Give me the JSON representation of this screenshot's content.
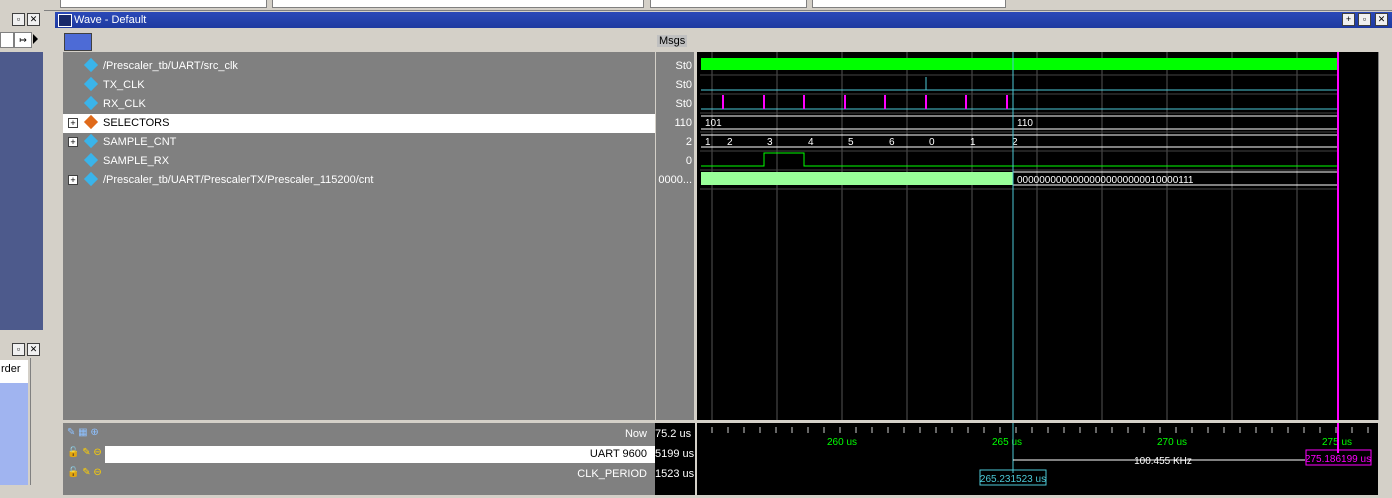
{
  "window": {
    "title": "Wave - Default",
    "toolbar_msgs_label": "Msgs"
  },
  "left_panel": {
    "list_item": "rder"
  },
  "signals": [
    {
      "name": "/Prescaler_tb/UART/src_clk",
      "value": "St0",
      "icon": "wire-icon",
      "expandable": false,
      "selected": false
    },
    {
      "name": "TX_CLK",
      "value": "St0",
      "icon": "wire-icon",
      "expandable": false,
      "selected": false
    },
    {
      "name": "RX_CLK",
      "value": "St0",
      "icon": "wire-icon",
      "expandable": false,
      "selected": false
    },
    {
      "name": "SELECTORS",
      "value": "110",
      "icon": "bus-icon",
      "expandable": true,
      "selected": true
    },
    {
      "name": "SAMPLE_CNT",
      "value": "2",
      "icon": "wire-icon",
      "expandable": true,
      "selected": false
    },
    {
      "name": "SAMPLE_RX",
      "value": "0",
      "icon": "wire-icon",
      "expandable": false,
      "selected": false
    },
    {
      "name": "/Prescaler_tb/UART/PrescalerTX/Prescaler_115200/cnt",
      "value": "0000...",
      "icon": "wire-icon",
      "expandable": true,
      "selected": false
    }
  ],
  "waveform_labels": {
    "selectors_before": "101",
    "selectors_after": "110",
    "sample_cnt": [
      "1",
      "2",
      "3",
      "4",
      "5",
      "6",
      "0",
      "1",
      "2"
    ],
    "cnt_after": "00000000000000000000000010000111"
  },
  "time_axis": {
    "ticks": [
      "260 us",
      "265 us",
      "270 us",
      "275 us"
    ]
  },
  "cursors": [
    {
      "name": "Now",
      "value": "75.2 us"
    },
    {
      "name": "UART 9600",
      "value": "5199 us",
      "time_label": "275.186199 us",
      "freq_label": "100.455 KHz"
    },
    {
      "name": "CLK_PERIOD",
      "value": "1523 us",
      "time_label": "265.231523 us"
    }
  ],
  "colors": {
    "clock": "#00ff00",
    "cursor_magenta": "#ff00ff",
    "cursor_cyan": "#4cc9d6",
    "bus": "#ffffff"
  }
}
